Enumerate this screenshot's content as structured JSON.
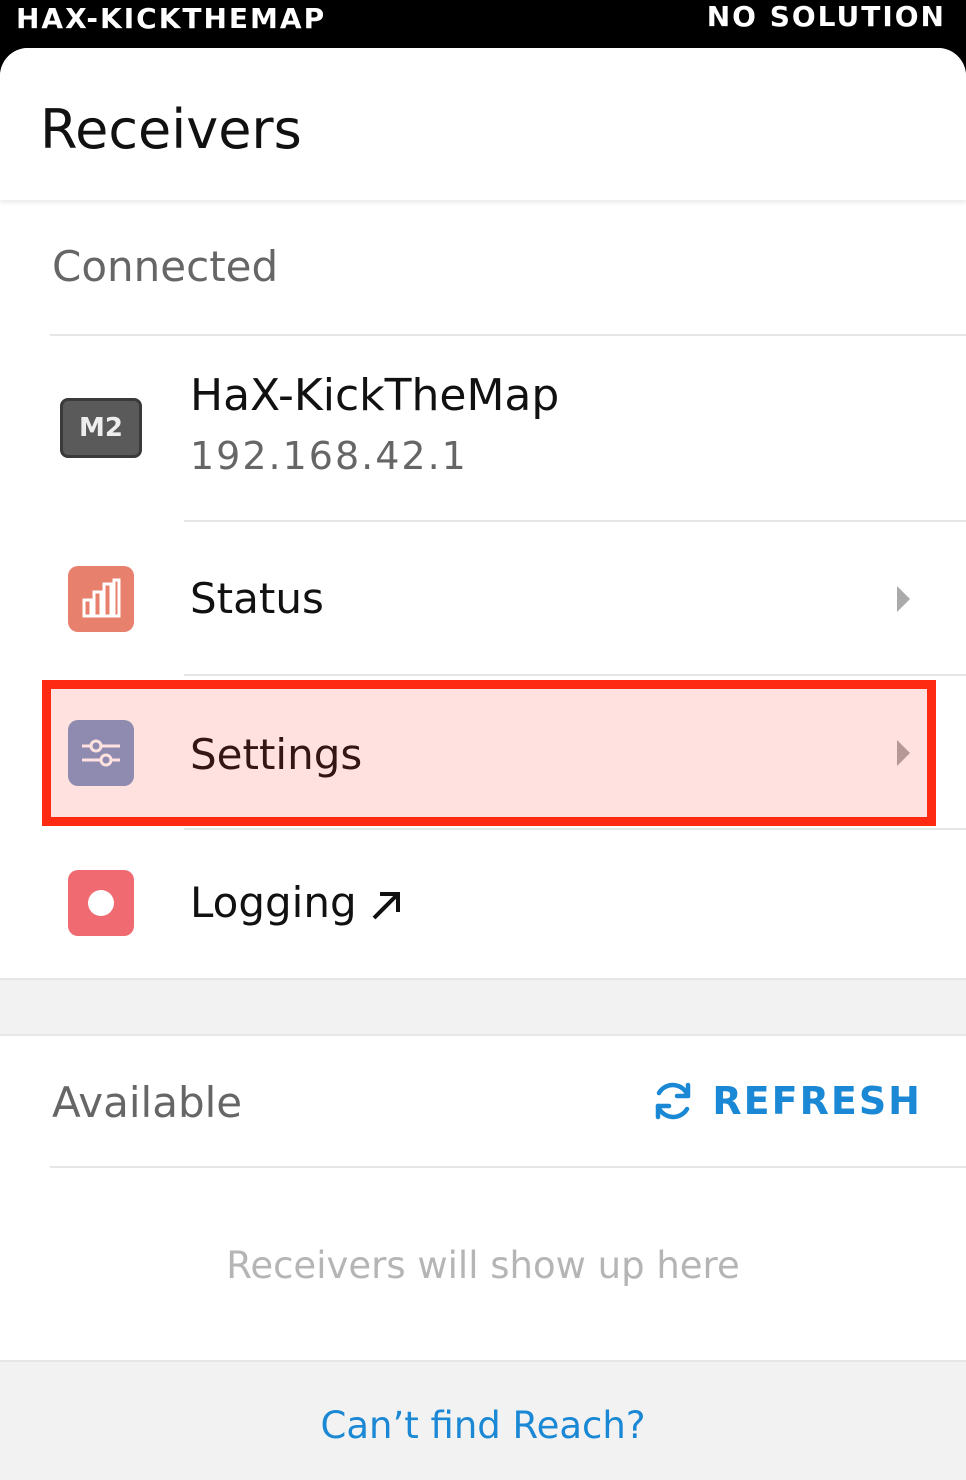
{
  "status_bar": {
    "left": "HAX-KICKTHEMAP",
    "right": "NO SOLUTION"
  },
  "header": {
    "title": "Receivers"
  },
  "connected": {
    "label": "Connected",
    "device": {
      "badge": "M2",
      "name": "HaX-KickTheMap",
      "ip": "192.168.42.1"
    },
    "items": [
      {
        "label": "Status",
        "icon": "bar-chart-icon",
        "color": "#e8806e"
      },
      {
        "label": "Settings",
        "icon": "sliders-icon",
        "color": "#7b98c8"
      },
      {
        "label": "Logging",
        "icon": "record-icon",
        "color": "#f06a72",
        "external_icon": "arrow-up-right-icon"
      }
    ]
  },
  "available": {
    "label": "Available",
    "refresh_label": "REFRESH",
    "empty_text": "Receivers will show up here"
  },
  "footer": {
    "link": "Can’t find Reach?"
  },
  "colors": {
    "accent": "#1a88d4",
    "highlight": "#ff2a12"
  }
}
